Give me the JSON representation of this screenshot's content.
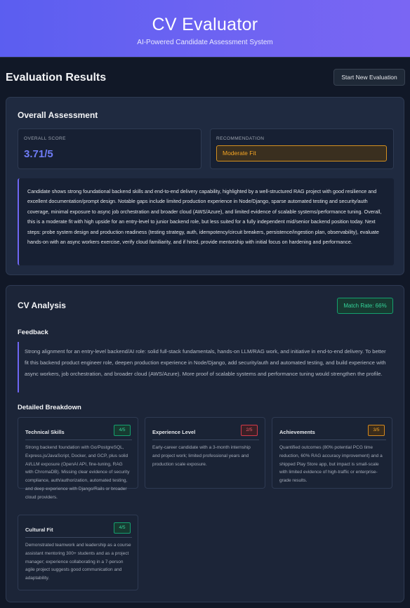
{
  "header": {
    "title": "CV Evaluator",
    "subtitle": "AI-Powered Candidate Assessment System"
  },
  "results": {
    "title": "Evaluation Results",
    "new_button": "Start New Evaluation"
  },
  "overall": {
    "title": "Overall Assessment",
    "score_label": "OVERALL SCORE",
    "score_value": "3.71/5",
    "recommendation_label": "RECOMMENDATION",
    "recommendation_value": "Moderate Fit",
    "summary": "Candidate shows strong foundational backend skills and end-to-end delivery capability, highlighted by a well-structured RAG project with good resilience and excellent documentation/prompt design. Notable gaps include limited production experience in Node/Django, sparse automated testing and security/auth coverage, minimal exposure to async job orchestration and broader cloud (AWS/Azure), and limited evidence of scalable systems/performance tuning. Overall, this is a moderate fit with high upside for an entry-level to junior backend role, but less suited for a fully independent mid/senior backend position today. Next steps: probe system design and production readiness (testing strategy, auth, idempotency/circuit breakers, persistence/ingestion plan, observability), evaluate hands-on with an async workers exercise, verify cloud familiarity, and if hired, provide mentorship with initial focus on hardening and performance."
  },
  "cv": {
    "title": "CV Analysis",
    "match_rate": "Match Rate: 66%",
    "feedback_title": "Feedback",
    "feedback": "Strong alignment for an entry-level backend/AI role: solid full-stack fundamentals, hands-on LLM/RAG work, and initiative in end-to-end delivery. To better fit this backend product engineer role, deepen production experience in Node/Django, add security/auth and automated testing, and build experience with async workers, job orchestration, and broader cloud (AWS/Azure). More proof of scalable systems and performance tuning would strengthen the profile.",
    "breakdown_title": "Detailed Breakdown",
    "metrics": [
      {
        "name": "Technical Skills",
        "score": "4/5",
        "status_color": "#34d399",
        "text": "Strong backend foundation with Go/PostgreSQL, Express.js/JavaScript, Docker, and GCP, plus solid AI/LLM exposure (OpenAI API, fine-tuning, RAG with ChromaDB). Missing clear evidence of security compliance, auth/authorization, automated testing, and deep experience with Django/Rails or broader cloud providers."
      },
      {
        "name": "Experience Level",
        "score": "2/5",
        "status_color": "#f05d6c",
        "text": "Early-career candidate with a 3-month internship and project work; limited professional years and production scale exposure."
      },
      {
        "name": "Achievements",
        "score": "3/5",
        "status_color": "#f5a524",
        "text": "Quantified outcomes (80% potential PCG time reduction, 60% RAG accuracy improvement) and a shipped Play Store app, but impact is small-scale with limited evidence of high-traffic or enterprise-grade results."
      },
      {
        "name": "Cultural Fit",
        "score": "4/5",
        "status_color": "#34d399",
        "text": "Demonstrated teamwork and leadership as a course assistant mentoring 300+ students and as a project manager; experience collaborating in a 7-person agile project suggests good communication and adaptability."
      }
    ]
  }
}
